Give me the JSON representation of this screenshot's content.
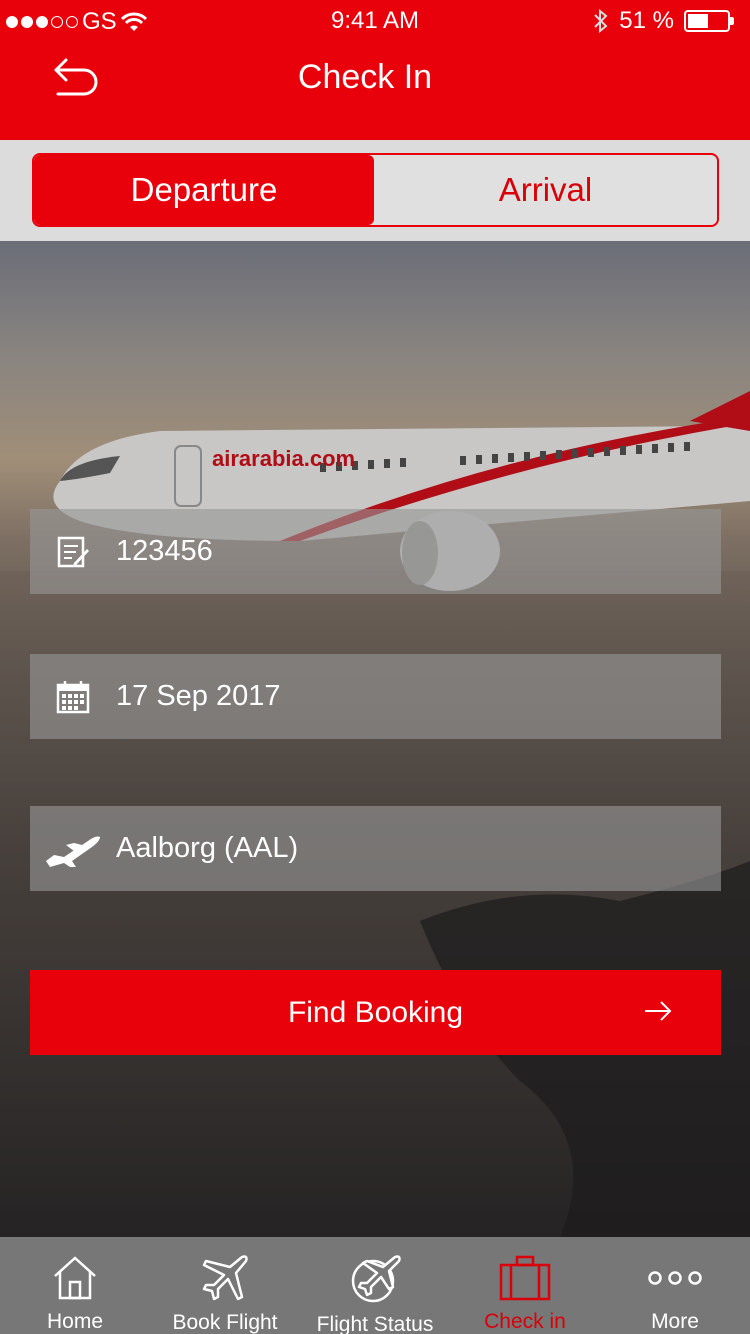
{
  "status_bar": {
    "carrier": "GS",
    "time": "9:41 AM",
    "battery": "51 %",
    "battery_level": 0.51
  },
  "header": {
    "title": "Check In",
    "back_icon": "back-arrow-icon"
  },
  "segment": {
    "departure_label": "Departure",
    "arrival_label": "Arrival",
    "selected": "Departure"
  },
  "form": {
    "booking_ref": "123456",
    "date": "17 Sep 2017",
    "airport": "Aalborg (AAL)"
  },
  "find_button": {
    "label": "Find Booking",
    "icon": "arrow-right-icon"
  },
  "tabs": [
    {
      "label": "Home",
      "icon": "home-icon"
    },
    {
      "label": "Book Flight",
      "icon": "plane-icon"
    },
    {
      "label": "Flight Status",
      "icon": "flight-status-icon"
    },
    {
      "label": "Check in",
      "icon": "briefcase-icon"
    },
    {
      "label": "More",
      "icon": "more-dots-icon"
    }
  ],
  "active_tab": "Check in",
  "colors": {
    "brand_red": "#e8000b",
    "tab_bar": "#777777",
    "segment_bg": "#dcdcdc"
  }
}
